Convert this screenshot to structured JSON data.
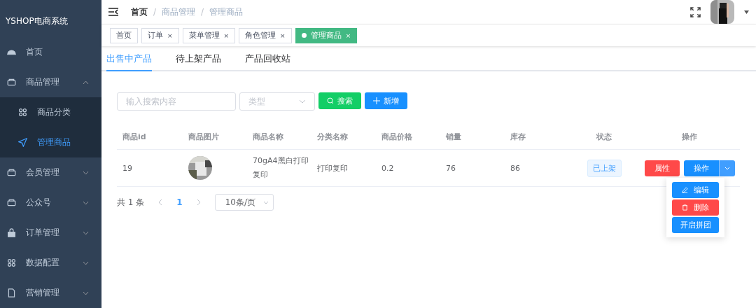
{
  "sidebar": {
    "title": "YSHOP电商系统",
    "items": [
      {
        "label": "首页",
        "selected": false
      },
      {
        "label": "商品管理",
        "expanded": true,
        "selected": false,
        "children": [
          {
            "label": "商品分类",
            "selected": false
          },
          {
            "label": "管理商品",
            "selected": true
          }
        ]
      },
      {
        "label": "会员管理",
        "expanded": false,
        "selected": false
      },
      {
        "label": "公众号",
        "expanded": false,
        "selected": false
      },
      {
        "label": "订单管理",
        "expanded": false,
        "selected": false
      },
      {
        "label": "数据配置",
        "expanded": false,
        "selected": false
      },
      {
        "label": "营销管理",
        "expanded": false,
        "selected": false
      }
    ]
  },
  "breadcrumb": {
    "separator": "/",
    "items": [
      "首页",
      "商品管理",
      "管理商品"
    ]
  },
  "tags": [
    {
      "label": "首页",
      "selected": false
    },
    {
      "label": "订单",
      "close": "×",
      "selected": false
    },
    {
      "label": "菜单管理",
      "close": "×",
      "selected": false
    },
    {
      "label": "角色管理",
      "close": "×",
      "selected": false
    },
    {
      "label": "管理商品",
      "close": "×",
      "selected": true
    }
  ],
  "tabs": [
    {
      "label": "出售中产品",
      "selected": true
    },
    {
      "label": "待上架产品",
      "selected": false
    },
    {
      "label": "产品回收站",
      "selected": false
    }
  ],
  "search": {
    "placeholder": "输入搜索内容"
  },
  "type_select": {
    "placeholder": "类型"
  },
  "search_button": "搜索",
  "add_button": "新增",
  "table": {
    "columns": [
      "商品id",
      "商品图片",
      "商品名称",
      "分类名称",
      "商品价格",
      "销量",
      "库存",
      "状态",
      "操作"
    ],
    "rows": [
      {
        "id": "19",
        "name": "70gA4黑白打印复印",
        "category": "打印复印",
        "price": "0.2",
        "sales": "76",
        "stock": "86",
        "status": "已上架",
        "attr_button": "属性",
        "op_button": "操作"
      }
    ]
  },
  "pagination": {
    "total": "共 1 条",
    "pages": [
      {
        "label": "1",
        "selected": true
      }
    ],
    "page_size": "10条/页"
  },
  "dropdown_menu": [
    {
      "label": "编辑",
      "kind": "edit"
    },
    {
      "label": "删除",
      "kind": "delete"
    },
    {
      "label": "开启拼团",
      "kind": "plain"
    }
  ]
}
